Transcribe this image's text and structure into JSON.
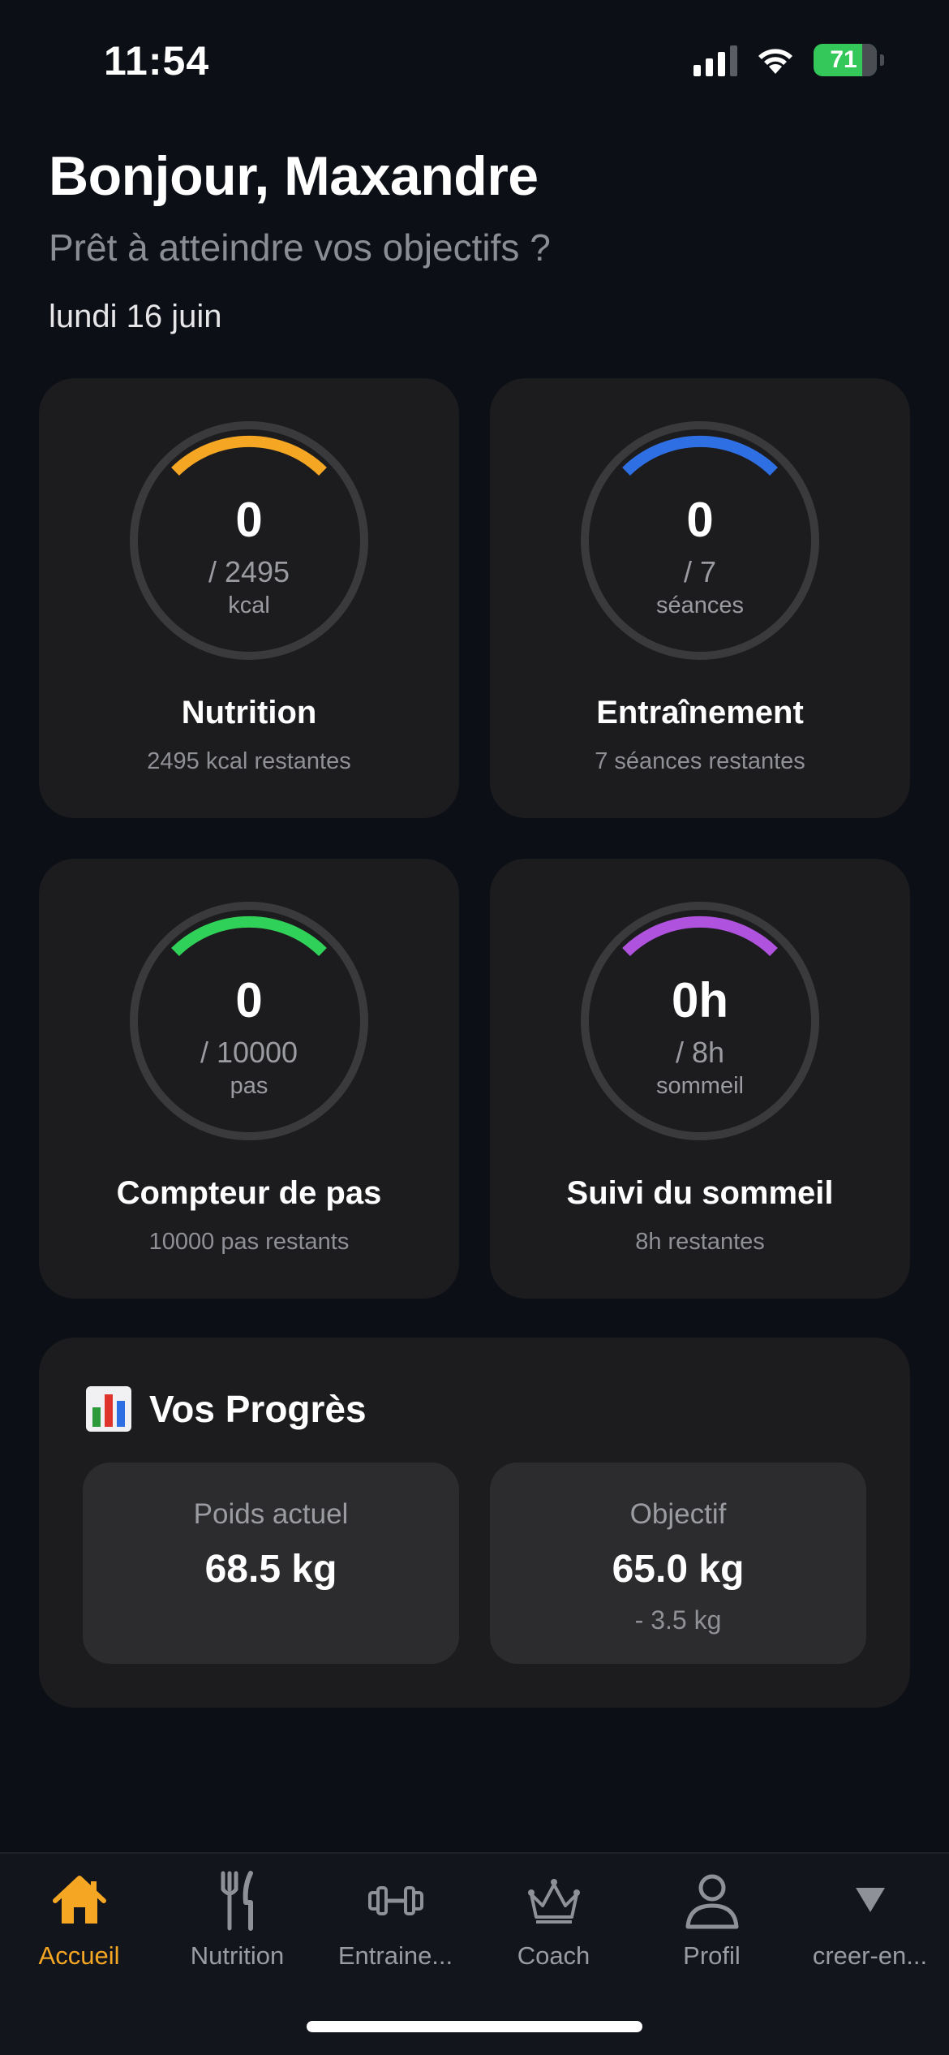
{
  "status_bar": {
    "time": "11:54",
    "battery": "71"
  },
  "header": {
    "greeting": "Bonjour, Maxandre",
    "subtitle": "Prêt à atteindre vos objectifs ?",
    "date": "lundi 16 juin"
  },
  "cards": [
    {
      "value": "0",
      "target": "/ 2495",
      "unit": "kcal",
      "title": "Nutrition",
      "subtitle": "2495 kcal restantes",
      "color": "#f5a623",
      "progress": 0
    },
    {
      "value": "0",
      "target": "/ 7",
      "unit": "séances",
      "title": "Entraînement",
      "subtitle": "7 séances restantes",
      "color": "#2f6fe4",
      "progress": 0
    },
    {
      "value": "0",
      "target": "/ 10000",
      "unit": "pas",
      "title": "Compteur de pas",
      "subtitle": "10000 pas restants",
      "color": "#30d158",
      "progress": 0
    },
    {
      "value": "0h",
      "target": "/ 8h",
      "unit": "sommeil",
      "title": "Suivi du sommeil",
      "subtitle": "8h restantes",
      "color": "#af52de",
      "progress": 0
    }
  ],
  "progress": {
    "title": "Vos Progrès",
    "icon": "bar-chart-icon",
    "current": {
      "label": "Poids actuel",
      "value": "68.5 kg"
    },
    "goal": {
      "label": "Objectif",
      "value": "65.0 kg",
      "diff": "- 3.5 kg"
    }
  },
  "tabs": [
    {
      "label": "Accueil",
      "icon": "home-icon",
      "active": true
    },
    {
      "label": "Nutrition",
      "icon": "fork-knife-icon",
      "active": false
    },
    {
      "label": "Entraine...",
      "icon": "dumbbell-icon",
      "active": false
    },
    {
      "label": "Coach",
      "icon": "crown-icon",
      "active": false
    },
    {
      "label": "Profil",
      "icon": "person-icon",
      "active": false
    },
    {
      "label": "creer-en...",
      "icon": "triangle-down-icon",
      "active": false
    }
  ],
  "colors": {
    "accent": "#f5a623",
    "background": "#0c0f16",
    "card": "#1c1c1e"
  }
}
